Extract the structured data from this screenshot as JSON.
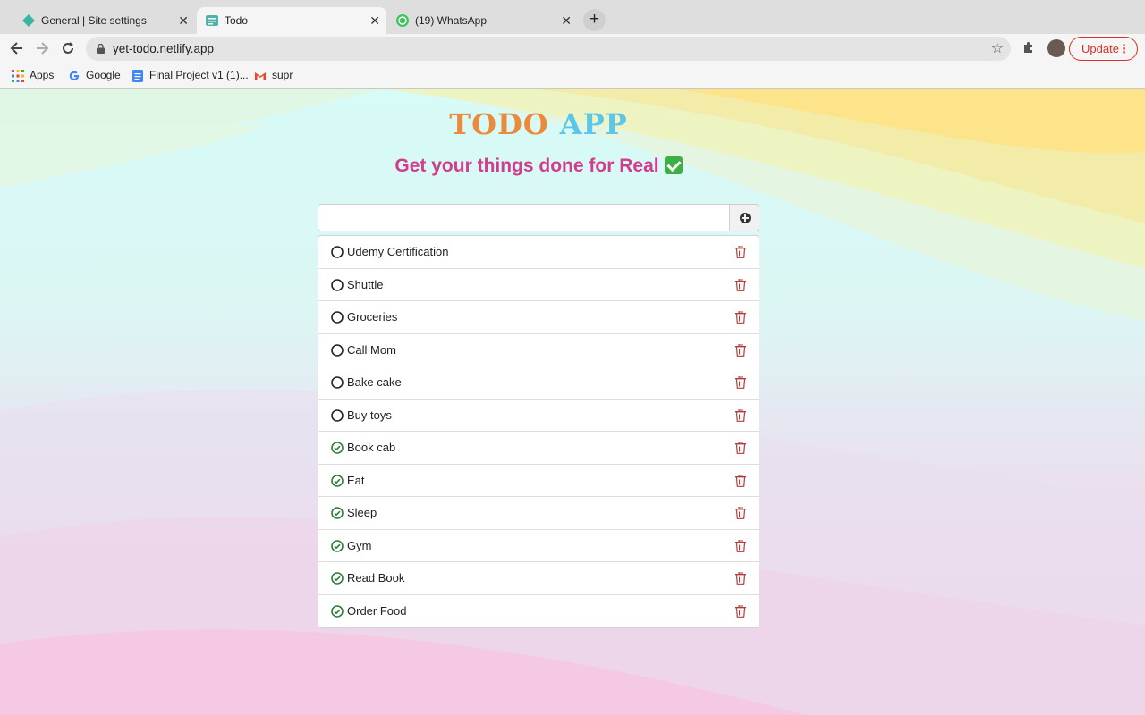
{
  "browser": {
    "tabs": [
      {
        "title": "General | Site settings",
        "icon": "netlify-diamond-icon",
        "active": false
      },
      {
        "title": "Todo",
        "icon": "todo-app-icon",
        "active": true
      },
      {
        "title": "(19) WhatsApp",
        "icon": "whatsapp-icon",
        "active": false
      }
    ],
    "new_tab_label": "+",
    "url": "yet-todo.netlify.app",
    "update_label": "Update",
    "bookmarks": [
      {
        "label": "Apps",
        "icon": "apps-grid-icon"
      },
      {
        "label": "Google",
        "icon": "google-icon"
      },
      {
        "label": "Final Project v1 (1)...",
        "icon": "docs-icon"
      },
      {
        "label": "supr",
        "icon": "gmail-icon"
      }
    ]
  },
  "app": {
    "title_part1": "TODO",
    "title_part2": "APP",
    "subtitle": "Get your things done for Real",
    "input": {
      "value": "",
      "placeholder": ""
    },
    "colors": {
      "title1": "#ea8a3a",
      "title2": "#5cc6e8",
      "subtitle": "#d23d8b",
      "done": "#2e7d3a",
      "trash": "#b23a3a"
    },
    "todos": [
      {
        "label": "Udemy Certification",
        "done": false
      },
      {
        "label": "Shuttle",
        "done": false
      },
      {
        "label": "Groceries",
        "done": false
      },
      {
        "label": "Call Mom",
        "done": false
      },
      {
        "label": "Bake cake",
        "done": false
      },
      {
        "label": "Buy toys",
        "done": false
      },
      {
        "label": "Book cab",
        "done": true
      },
      {
        "label": "Eat",
        "done": true
      },
      {
        "label": "Sleep",
        "done": true
      },
      {
        "label": "Gym",
        "done": true
      },
      {
        "label": "Read Book",
        "done": true
      },
      {
        "label": "Order Food",
        "done": true
      }
    ]
  }
}
